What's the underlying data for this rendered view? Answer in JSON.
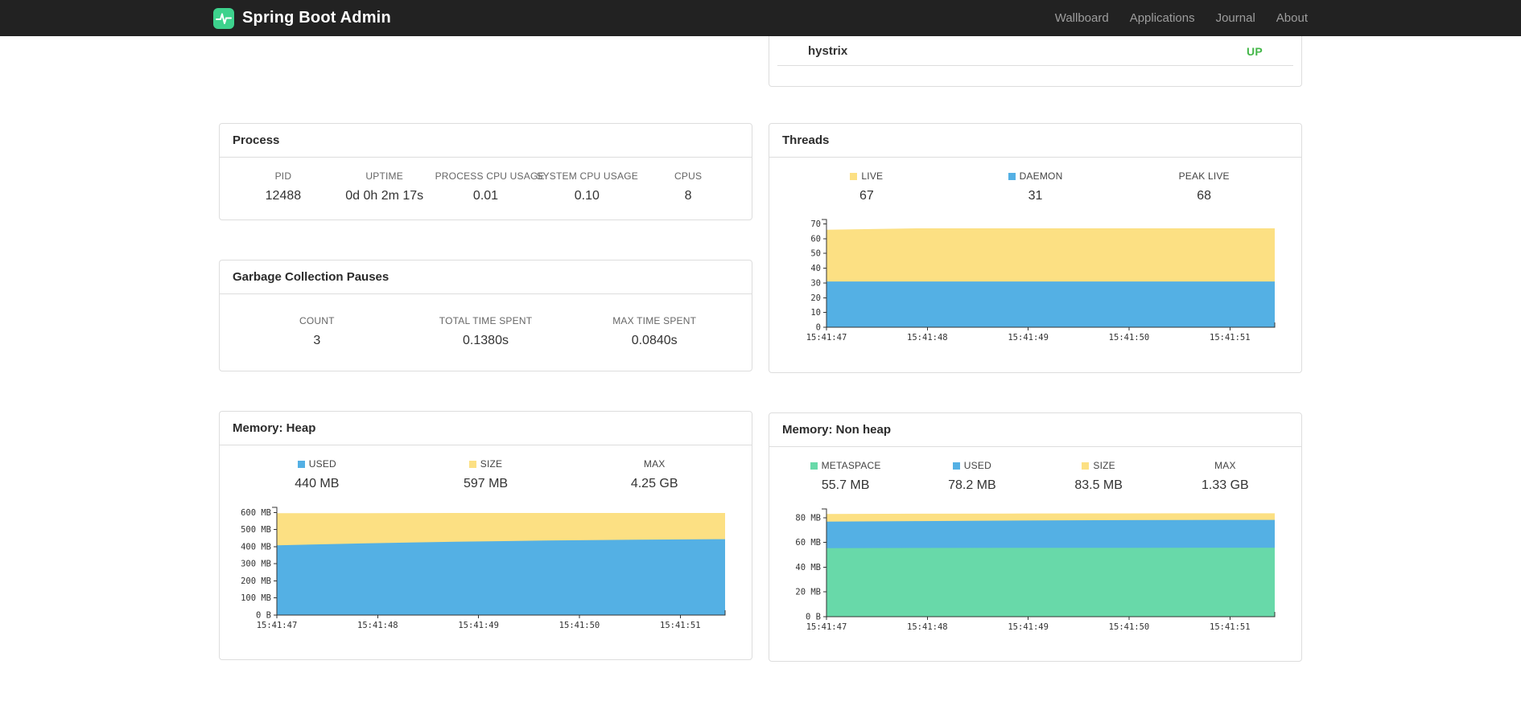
{
  "colors": {
    "navbar-bg": "#222222",
    "nav-link": "#9d9d9d",
    "brand-green": "#3dd28d",
    "status-up": "#44b749",
    "chart-yellow": "#fce083",
    "chart-blue": "#54b0e4",
    "chart-green": "#68d9a9",
    "card-border": "#dddddd"
  },
  "navbar": {
    "brand": "Spring Boot Admin",
    "links": [
      "Wallboard",
      "Applications",
      "Journal",
      "About"
    ]
  },
  "health": {
    "service": "hystrix",
    "status": "UP"
  },
  "process": {
    "title": "Process",
    "stats": [
      {
        "label": "PID",
        "value": "12488"
      },
      {
        "label": "UPTIME",
        "value": "0d 0h 2m 17s"
      },
      {
        "label": "PROCESS CPU USAGE",
        "value": "0.01"
      },
      {
        "label": "SYSTEM CPU USAGE",
        "value": "0.10"
      },
      {
        "label": "CPUS",
        "value": "8"
      }
    ]
  },
  "gc": {
    "title": "Garbage Collection Pauses",
    "stats": [
      {
        "label": "COUNT",
        "value": "3"
      },
      {
        "label": "TOTAL TIME SPENT",
        "value": "0.1380s"
      },
      {
        "label": "MAX TIME SPENT",
        "value": "0.0840s"
      }
    ]
  },
  "threads": {
    "title": "Threads",
    "legend": [
      {
        "label": "LIVE",
        "value": "67",
        "color": "#fce083"
      },
      {
        "label": "DAEMON",
        "value": "31",
        "color": "#54b0e4"
      },
      {
        "label": "PEAK LIVE",
        "value": "68",
        "color": null
      }
    ]
  },
  "memory_heap": {
    "title": "Memory: Heap",
    "legend": [
      {
        "label": "USED",
        "value": "440 MB",
        "color": "#54b0e4"
      },
      {
        "label": "SIZE",
        "value": "597 MB",
        "color": "#fce083"
      },
      {
        "label": "MAX",
        "value": "4.25 GB",
        "color": null
      }
    ]
  },
  "memory_nonheap": {
    "title": "Memory: Non heap",
    "legend": [
      {
        "label": "METASPACE",
        "value": "55.7 MB",
        "color": "#68d9a9"
      },
      {
        "label": "USED",
        "value": "78.2 MB",
        "color": "#54b0e4"
      },
      {
        "label": "SIZE",
        "value": "83.5 MB",
        "color": "#fce083"
      },
      {
        "label": "MAX",
        "value": "1.33 GB",
        "color": null
      }
    ]
  },
  "chart_data": [
    {
      "id": "threads",
      "type": "area",
      "stacked": true,
      "note": "series values are cumulative stack tops, drawn back-to-front",
      "x_labels": [
        "15:41:47",
        "15:41:48",
        "15:41:49",
        "15:41:50",
        "15:41:51"
      ],
      "ymax": 73,
      "yticks": [
        {
          "v": 0,
          "label": "0"
        },
        {
          "v": 10,
          "label": "10"
        },
        {
          "v": 20,
          "label": "20"
        },
        {
          "v": 30,
          "label": "30"
        },
        {
          "v": 40,
          "label": "40"
        },
        {
          "v": 50,
          "label": "50"
        },
        {
          "v": 60,
          "label": "60"
        },
        {
          "v": 70,
          "label": "70"
        }
      ],
      "series": [
        {
          "name": "LIVE",
          "color": "#fce083",
          "values": [
            66,
            67,
            67,
            67,
            67,
            67
          ]
        },
        {
          "name": "DAEMON",
          "color": "#54b0e4",
          "values": [
            31,
            31,
            31,
            31,
            31,
            31
          ]
        }
      ]
    },
    {
      "id": "memory-heap",
      "type": "area",
      "stacked": true,
      "note": "series values are cumulative stack tops, drawn back-to-front",
      "x_labels": [
        "15:41:47",
        "15:41:48",
        "15:41:49",
        "15:41:50",
        "15:41:51"
      ],
      "ymax": 630,
      "yticks": [
        {
          "v": 0,
          "label": "0 B"
        },
        {
          "v": 100,
          "label": "100 MB"
        },
        {
          "v": 200,
          "label": "200 MB"
        },
        {
          "v": 300,
          "label": "300 MB"
        },
        {
          "v": 400,
          "label": "400 MB"
        },
        {
          "v": 500,
          "label": "500 MB"
        },
        {
          "v": 600,
          "label": "600 MB"
        }
      ],
      "series": [
        {
          "name": "SIZE",
          "color": "#fce083",
          "values": [
            596,
            596,
            597,
            597,
            597,
            597
          ]
        },
        {
          "name": "USED",
          "color": "#54b0e4",
          "values": [
            408,
            420,
            429,
            436,
            441,
            444
          ]
        }
      ]
    },
    {
      "id": "memory-nonheap",
      "type": "area",
      "stacked": true,
      "note": "series values are cumulative stack tops, drawn back-to-front",
      "x_labels": [
        "15:41:47",
        "15:41:48",
        "15:41:49",
        "15:41:50",
        "15:41:51"
      ],
      "ymax": 87,
      "yticks": [
        {
          "v": 0,
          "label": "0 B"
        },
        {
          "v": 20,
          "label": "20 MB"
        },
        {
          "v": 40,
          "label": "40 MB"
        },
        {
          "v": 60,
          "label": "60 MB"
        },
        {
          "v": 80,
          "label": "80 MB"
        }
      ],
      "series": [
        {
          "name": "SIZE",
          "color": "#fce083",
          "values": [
            83.0,
            83.2,
            83.3,
            83.4,
            83.5,
            83.5
          ]
        },
        {
          "name": "USED",
          "color": "#54b0e4",
          "values": [
            76.8,
            77.2,
            77.6,
            77.9,
            78.1,
            78.2
          ]
        },
        {
          "name": "METASPACE",
          "color": "#68d9a9",
          "values": [
            55.4,
            55.5,
            55.6,
            55.6,
            55.7,
            55.7
          ]
        }
      ]
    }
  ]
}
